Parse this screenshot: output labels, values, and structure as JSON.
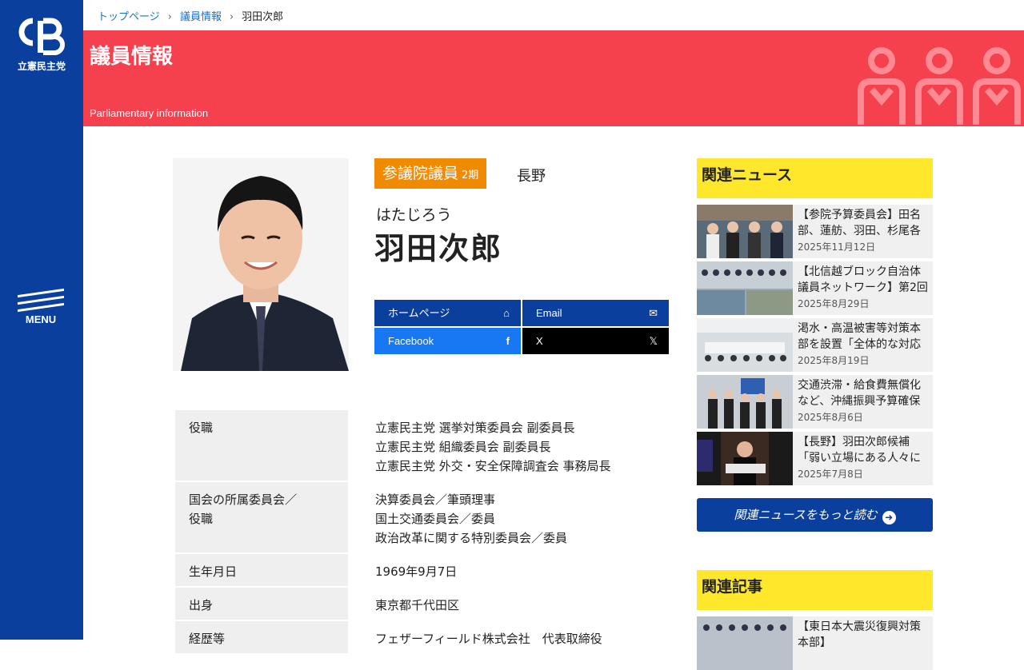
{
  "brand": {
    "logo_mark": "CDP",
    "party_name": "立憲民主党",
    "accent": "#0b3f9e",
    "banner_color": "#f5404d"
  },
  "menu": {
    "label": "MENU"
  },
  "breadcrumb": {
    "items": [
      "トップページ",
      "議員情報",
      "羽田次郎"
    ]
  },
  "banner": {
    "title": "議員情報",
    "subtitle": "Parliamentary information"
  },
  "profile": {
    "role": "参議院議員",
    "term": "2期",
    "district": "長野",
    "kana": "はたじろう",
    "name": "羽田次郎"
  },
  "links": {
    "homepage": "ホームページ",
    "email": "Email",
    "facebook": "Facebook",
    "x": "X"
  },
  "info": [
    {
      "label": "役職",
      "lines": [
        "立憲民主党 選挙対策委員会 副委員長",
        "立憲民主党 組織委員会 副委員長",
        "立憲民主党 外交・安全保障調査会 事務局長"
      ]
    },
    {
      "label": "国会の所属委員会／役職",
      "lines": [
        "決算委員会／筆頭理事",
        "国土交通委員会／委員",
        "政治改革に関する特別委員会／委員"
      ]
    },
    {
      "label": "生年月日",
      "lines": [
        "1969年9月7日"
      ]
    },
    {
      "label": "出身",
      "lines": [
        "東京都千代田区"
      ]
    },
    {
      "label": "経歴等",
      "lines": [
        "フェザーフィールド株式会社　代表取締役"
      ]
    }
  ],
  "related_news": {
    "title": "関連ニュース",
    "items": [
      {
        "title": "【参院予算委員会】田名部、蓮舫、羽田、杉尾各",
        "date": "2025年11月12日"
      },
      {
        "title": "【北信越ブロック自治体議員ネットワーク】第2回",
        "date": "2025年8月29日"
      },
      {
        "title": "渇水・高温被害等対策本部を設置「全体的な対応",
        "date": "2025年8月19日"
      },
      {
        "title": "交通渋滞・給食費無償化など、沖縄振興予算確保",
        "date": "2025年8月6日"
      },
      {
        "title": "【長野】羽田次郎候補「弱い立場にある人々に光を",
        "date": "2025年7月8日"
      }
    ],
    "more_label": "関連ニュースをもっと読む"
  },
  "related_articles": {
    "title": "関連記事",
    "items": [
      {
        "title": "【東日本大震災復興対策本部】",
        "date": ""
      }
    ]
  }
}
